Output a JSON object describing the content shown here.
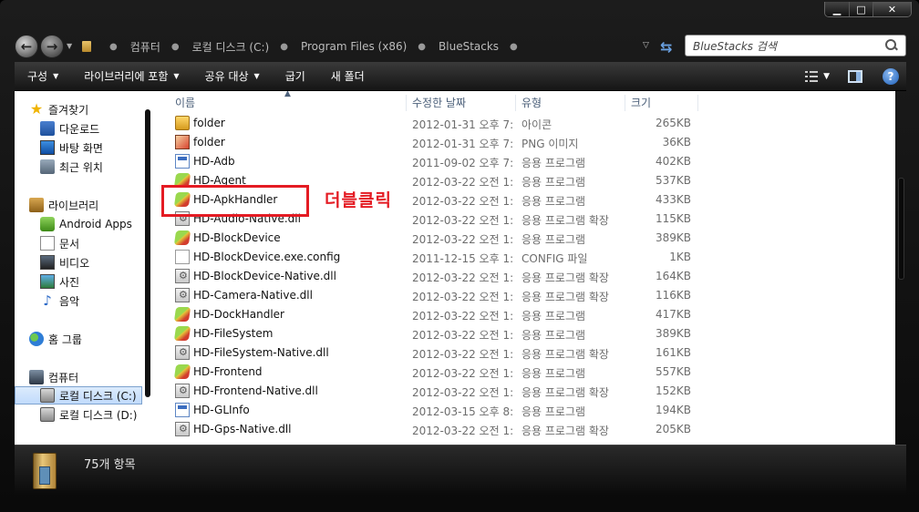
{
  "caption": {
    "minimize": "▁",
    "maximize": "□",
    "close": "✕"
  },
  "address": {
    "crumbs": [
      "컴퓨터",
      "로컬 디스크 (C:)",
      "Program Files (x86)",
      "BlueStacks"
    ],
    "search_placeholder": "BlueStacks 검색"
  },
  "toolbar": {
    "organize": "구성",
    "include_library": "라이브러리에 포함",
    "share": "공유 대상",
    "burn": "굽기",
    "new_folder": "새 폴더"
  },
  "nav": {
    "favorites": "즐겨찾기",
    "downloads": "다운로드",
    "desktop": "바탕 화면",
    "recent": "최근 위치",
    "libraries": "라이브러리",
    "android_apps": "Android Apps",
    "documents": "문서",
    "videos": "비디오",
    "pictures": "사진",
    "music": "음악",
    "homegroup": "홈 그룹",
    "computer": "컴퓨터",
    "drive_c": "로컬 디스크 (C:)",
    "drive_d": "로컬 디스크 (D:)"
  },
  "columns": {
    "name": "이름",
    "date": "수정한 날짜",
    "type": "유형",
    "size": "크기"
  },
  "files": [
    {
      "name": "folder",
      "date": "2012-01-31 오후 7:...",
      "type": "아이콘",
      "size": "265KB",
      "icon": "folder-icon"
    },
    {
      "name": "folder",
      "date": "2012-01-31 오후 7:...",
      "type": "PNG 이미지",
      "size": "36KB",
      "icon": "png-icon"
    },
    {
      "name": "HD-Adb",
      "date": "2011-09-02 오후 7:...",
      "type": "응용 프로그램",
      "size": "402KB",
      "icon": "app-icon"
    },
    {
      "name": "HD-Agent",
      "date": "2012-03-22 오전 1:...",
      "type": "응용 프로그램",
      "size": "537KB",
      "icon": "bluestacks-icon"
    },
    {
      "name": "HD-ApkHandler",
      "date": "2012-03-22 오전 1:...",
      "type": "응용 프로그램",
      "size": "433KB",
      "icon": "bluestacks-icon"
    },
    {
      "name": "HD-Audio-Native.dll",
      "date": "2012-03-22 오전 1:...",
      "type": "응용 프로그램 확장",
      "size": "115KB",
      "icon": "dll-icon"
    },
    {
      "name": "HD-BlockDevice",
      "date": "2012-03-22 오전 1:...",
      "type": "응용 프로그램",
      "size": "389KB",
      "icon": "bluestacks-icon"
    },
    {
      "name": "HD-BlockDevice.exe.config",
      "date": "2011-12-15 오후 1:...",
      "type": "CONFIG 파일",
      "size": "1KB",
      "icon": "config-file-icon"
    },
    {
      "name": "HD-BlockDevice-Native.dll",
      "date": "2012-03-22 오전 1:...",
      "type": "응용 프로그램 확장",
      "size": "164KB",
      "icon": "dll-icon"
    },
    {
      "name": "HD-Camera-Native.dll",
      "date": "2012-03-22 오전 1:...",
      "type": "응용 프로그램 확장",
      "size": "116KB",
      "icon": "dll-icon"
    },
    {
      "name": "HD-DockHandler",
      "date": "2012-03-22 오전 1:...",
      "type": "응용 프로그램",
      "size": "417KB",
      "icon": "bluestacks-icon"
    },
    {
      "name": "HD-FileSystem",
      "date": "2012-03-22 오전 1:...",
      "type": "응용 프로그램",
      "size": "389KB",
      "icon": "bluestacks-icon"
    },
    {
      "name": "HD-FileSystem-Native.dll",
      "date": "2012-03-22 오전 1:...",
      "type": "응용 프로그램 확장",
      "size": "161KB",
      "icon": "dll-icon"
    },
    {
      "name": "HD-Frontend",
      "date": "2012-03-22 오전 1:...",
      "type": "응용 프로그램",
      "size": "557KB",
      "icon": "bluestacks-icon"
    },
    {
      "name": "HD-Frontend-Native.dll",
      "date": "2012-03-22 오전 1:...",
      "type": "응용 프로그램 확장",
      "size": "152KB",
      "icon": "dll-icon"
    },
    {
      "name": "HD-GLInfo",
      "date": "2012-03-15 오후 8:...",
      "type": "응용 프로그램",
      "size": "194KB",
      "icon": "app-icon"
    },
    {
      "name": "HD-Gps-Native.dll",
      "date": "2012-03-22 오전 1:...",
      "type": "응용 프로그램 확장",
      "size": "205KB",
      "icon": "dll-icon"
    }
  ],
  "annotation": "더블클릭",
  "status": {
    "item_count": "75개 항목"
  },
  "colors": {
    "highlight": "#e41b23",
    "header_text": "#4c607a"
  }
}
